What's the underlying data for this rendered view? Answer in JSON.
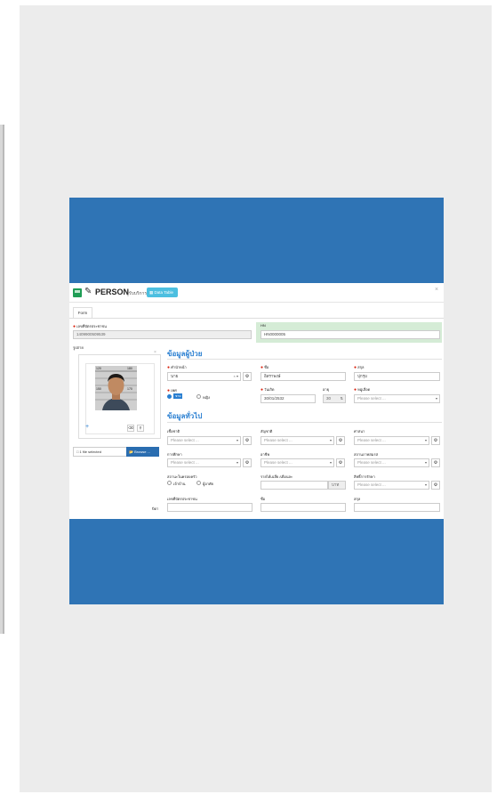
{
  "app": {
    "title": "PERSON",
    "subtitle": "ผู้รับบริการ",
    "data_table_label": "Data Table",
    "close": "×"
  },
  "tabs": [
    {
      "label": "Form"
    }
  ],
  "ids": {
    "citizen_id_label": "เลขที่บัตรประชาชน",
    "citizen_id_value": "1409900509539",
    "hn_label": "HN",
    "hn_value": "HN0000005"
  },
  "photo": {
    "label": "รูปถ่าย",
    "close": "×",
    "file_status": "1 file selected",
    "browse_label": "Browse ..."
  },
  "patient_section": {
    "title": "ข้อมูลผู้ป่วย",
    "prefix_label": "คำนำหน้า",
    "prefix_value": "นาย",
    "firstname_label": "ชื่อ",
    "firstname_value": "อิสราพงษ์",
    "lastname_label": "สกุล",
    "lastname_value": "ปุกรุม",
    "sex_label": "เพศ",
    "sex_male": "ชาย",
    "sex_female": "หญิง",
    "dob_label": "วันเกิด",
    "dob_value": "30/01/2532",
    "age_label": "อายุ",
    "age_value": "30",
    "blood_label": "หมู่เลือด",
    "blood_placeholder": "Please select ..."
  },
  "general_section": {
    "title": "ข้อมูลทั่วไป",
    "race_label": "เชื้อชาติ",
    "nationality_label": "สัญชาติ",
    "religion_label": "ศาสนา",
    "education_label": "การศึกษา",
    "occupation_label": "อาชีพ",
    "marital_label": "สถานภาพสมรส",
    "placeholder": "Please select ...",
    "family_status_label": "สถานะในครอบครัว",
    "family_head": "เจ้าบ้าน",
    "family_resident": "ผู้อาศัย",
    "income_label": "รายได้เฉลี่ย /เดือนละ",
    "income_unit": "บาท",
    "rights_label": "สิทธิ์การรักษา",
    "father_row_label": "บิดา",
    "father_citizen_label": "เลขที่บัตรประชาชน",
    "father_name_label": "ชื่อ",
    "father_lastname_label": "สกุล"
  },
  "photo_ruler": [
    "120",
    "180",
    "150",
    "170"
  ],
  "colors": {
    "slide_blue": "#2f74b5",
    "accent_blue": "#2a7fd1",
    "hn_green": "#d5ecd6",
    "btn_cyan": "#4cbfe0"
  }
}
